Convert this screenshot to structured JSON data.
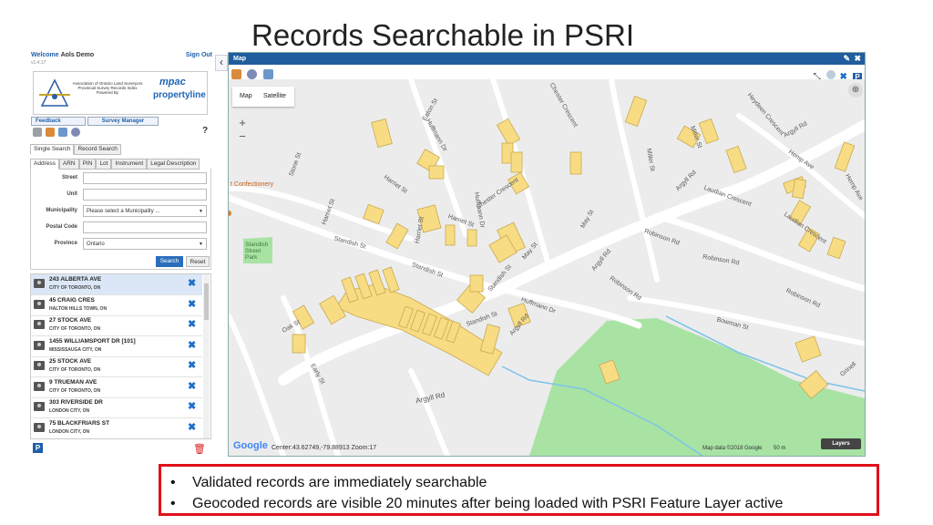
{
  "slide_title": "Records Searchable in PSRI",
  "app": {
    "welcome_label": "Welcome",
    "user_name": "Aols Demo",
    "version": "v1.4.17",
    "sign_out_label": "Sign Out",
    "logo": {
      "association_text": "Association of Ontario Land Surveyors Provincial Survey Records Index Powered By",
      "mpac": "mpac",
      "propertyline": "propertyline"
    },
    "feedback_label": "Feedback",
    "survey_manager_label": "Survey Manager",
    "help_label": "?",
    "search_tabs": [
      "Single Search",
      "Record Search"
    ],
    "field_tabs": [
      "Address",
      "ARN",
      "PIN",
      "Lot",
      "Instrument",
      "Legal Description"
    ],
    "form": {
      "street_label": "Street",
      "street_value": "",
      "unit_label": "Unit",
      "unit_value": "",
      "municipality_label": "Municipality",
      "municipality_value": "Please select a Municipality ...",
      "postal_code_label": "Postal Code",
      "postal_code_value": "",
      "province_label": "Province",
      "province_value": "Ontario",
      "search_button": "Search",
      "reset_button": "Reset"
    },
    "results": [
      {
        "address": "243 ALBERTA AVE",
        "city": "CITY OF TORONTO, ON"
      },
      {
        "address": "45 CRAIG CRES",
        "city": "HALTON HILLS TOWN, ON"
      },
      {
        "address": "27 STOCK AVE",
        "city": "CITY OF TORONTO, ON"
      },
      {
        "address": "1455 WILLIAMSPORT DR [101]",
        "city": "MISSISSAUGA CITY, ON"
      },
      {
        "address": "25 STOCK AVE",
        "city": "CITY OF TORONTO, ON"
      },
      {
        "address": "9 TRUEMAN AVE",
        "city": "CITY OF TORONTO, ON"
      },
      {
        "address": "303 RIVERSIDE DR",
        "city": "LONDON CITY, ON"
      },
      {
        "address": "75 BLACKFRIARS ST",
        "city": "LONDON CITY, ON"
      }
    ],
    "remove_icon": "close-icon",
    "p_badge": "P",
    "collapse_glyph": "‹"
  },
  "map": {
    "title": "Map",
    "map_type_map": "Map",
    "map_type_satellite": "Satellite",
    "zoom_in": "+",
    "zoom_out": "−",
    "footer_google": "Google",
    "center_readout": "Center:43.62749,-79.88913 Zoom:17",
    "map_data": "Map data ©2018 Google",
    "scale": "50 m",
    "layers_button": "Layers",
    "streets": {
      "confectionery": "t Confectionery",
      "park": "Standish Street Park",
      "argyll1": "Argyll Rd",
      "argyll2": "Argyll Rd",
      "argyll3": "Argyll Rd",
      "argyll4": "Argyll Rd",
      "argyll5": "Argyll Rd",
      "standish1": "Standish St",
      "standish2": "Standish St",
      "standish3": "Standish St",
      "standish4": "Standish St",
      "robinson1": "Robinson Rd",
      "robinson2": "Robinson Rd",
      "robinson3": "Robinson Rd",
      "robinson4": "Robinson Rd",
      "laudian1": "Laudian Crescent",
      "laudian2": "Laudian Crescent",
      "harriet1": "Harriet St",
      "harriet2": "Harriet St",
      "harriet3": "Harriet St",
      "harriet4": "Harriet St",
      "huffmann1": "Huffmann Dr",
      "huffmann2": "Huffmann Dr",
      "huffmann3": "Huffmann Dr",
      "may1": "May St",
      "may2": "May St",
      "miller1": "Miller St",
      "miller2": "Miller St",
      "chester1": "Chester Crescent",
      "chester2": "Chester Crescent",
      "eaton": "Eaton St",
      "stone": "Stone St",
      "oak": "Oak St",
      "early": "Early St",
      "bowman": "Bowman St",
      "heydeen": "Heydeen Crescent",
      "hemp1": "Hemp Ave",
      "hemp2": "Hemp Ave",
      "grinell": "Grinell"
    }
  },
  "bullets": [
    "Validated records are immediately searchable",
    "Geocoded records are visible 20 minutes after being loaded with PSRI Feature Layer active"
  ],
  "colors": {
    "header_blue": "#1f5d9e",
    "parcel_yellow": "#f7dc84",
    "park_green": "#a8e3a4",
    "callout_red": "#e0101a"
  }
}
